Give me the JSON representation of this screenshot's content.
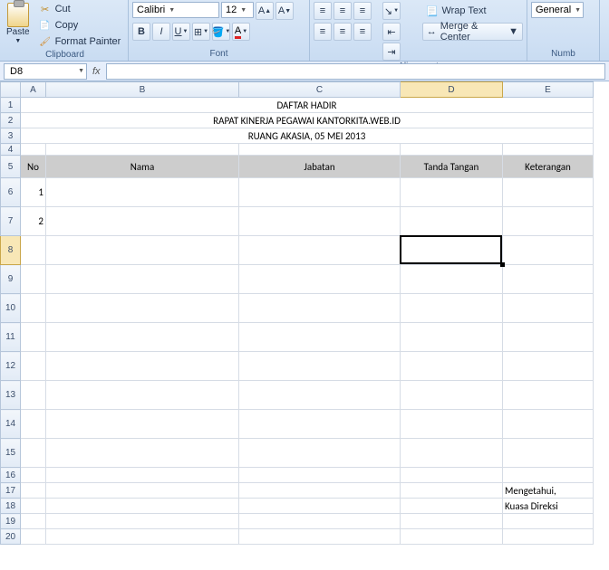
{
  "ribbon": {
    "clipboard": {
      "paste": "Paste",
      "cut": "Cut",
      "copy": "Copy",
      "format_painter": "Format Painter",
      "group_label": "Clipboard"
    },
    "font": {
      "name": "Calibri",
      "size": "12",
      "group_label": "Font"
    },
    "alignment": {
      "wrap": "Wrap Text",
      "merge": "Merge & Center",
      "group_label": "Alignment"
    },
    "number": {
      "format": "General",
      "group_label": "Numb"
    }
  },
  "namebox": "D8",
  "formula": "",
  "columns": [
    "A",
    "B",
    "C",
    "D",
    "E"
  ],
  "active_col": "D",
  "active_row": 8,
  "row_heights": {
    "1": 17,
    "2": 17,
    "3": 17,
    "4": 13,
    "5": 25,
    "6": 32,
    "7": 32,
    "8": 32,
    "9": 32,
    "10": 32,
    "11": 32,
    "12": 32,
    "13": 32,
    "14": 32,
    "15": 32,
    "16": 17,
    "17": 17,
    "18": 17,
    "19": 17,
    "20": 17
  },
  "doc": {
    "title1": "DAFTAR HADIR",
    "title2": "RAPAT KINERJA PEGAWAI KANTORKITA.WEB.ID",
    "title3": "RUANG AKASIA, 05 MEI 2013",
    "headers": [
      "No",
      "Nama",
      "Jabatan",
      "Tanda Tangan",
      "Keterangan"
    ],
    "rows": [
      {
        "no": "1"
      },
      {
        "no": "2"
      },
      {},
      {},
      {},
      {},
      {},
      {},
      {},
      {}
    ],
    "sign1": "Mengetahui,",
    "sign2": "Kuasa Direksi"
  },
  "chart_data": {
    "type": "table",
    "title": "DAFTAR HADIR",
    "subtitle": "RAPAT KINERJA PEGAWAI KANTORKITA.WEB.ID — RUANG AKASIA, 05 MEI 2013",
    "columns": [
      "No",
      "Nama",
      "Jabatan",
      "Tanda Tangan",
      "Keterangan"
    ],
    "rows": [
      {
        "No": 1,
        "Nama": "",
        "Jabatan": "",
        "Tanda Tangan": "",
        "Keterangan": ""
      },
      {
        "No": 2,
        "Nama": "",
        "Jabatan": "",
        "Tanda Tangan": "",
        "Keterangan": ""
      }
    ],
    "footer": [
      "Mengetahui,",
      "Kuasa Direksi"
    ]
  }
}
